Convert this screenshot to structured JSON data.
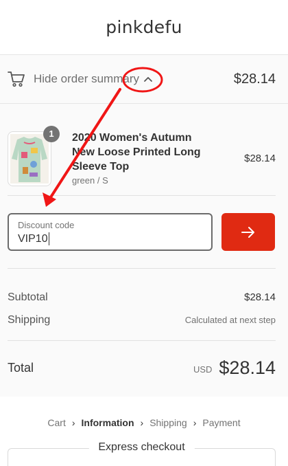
{
  "store": {
    "name": "pinkdefu"
  },
  "summary_toggle": {
    "label": "Hide order summary",
    "total": "$28.14"
  },
  "line_item": {
    "quantity": "1",
    "title": "2020 Women's Autumn New Loose Printed Long Sleeve Top",
    "variant": "green / S",
    "price": "$28.14"
  },
  "discount": {
    "label": "Discount code",
    "value": "VIP10"
  },
  "costs": {
    "subtotal_label": "Subtotal",
    "subtotal_value": "$28.14",
    "shipping_label": "Shipping",
    "shipping_value": "Calculated at next step"
  },
  "total": {
    "label": "Total",
    "currency": "USD",
    "value": "$28.14"
  },
  "breadcrumb": {
    "cart": "Cart",
    "information": "Information",
    "shipping": "Shipping",
    "payment": "Payment",
    "separator": "›"
  },
  "express": {
    "title": "Express checkout"
  },
  "colors": {
    "accent": "#e02a12",
    "annotation": "#f01616",
    "panel_bg": "#fafafa"
  }
}
